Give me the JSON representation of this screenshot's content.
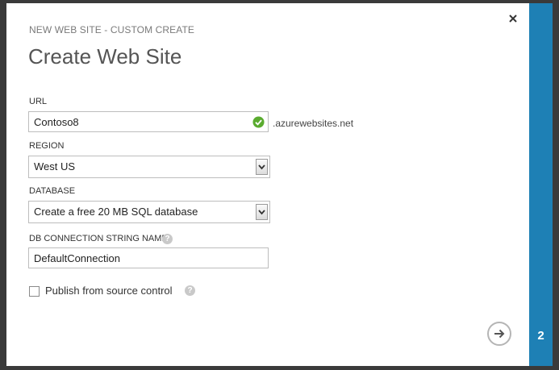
{
  "dialog": {
    "subtitle": "NEW WEB SITE - CUSTOM CREATE",
    "title": "Create Web Site",
    "step": "2"
  },
  "form": {
    "url": {
      "label": "URL",
      "value": "Contoso8",
      "suffix": ".azurewebsites.net",
      "status": "valid"
    },
    "region": {
      "label": "REGION",
      "selected": "West US"
    },
    "database": {
      "label": "DATABASE",
      "selected": "Create a free 20 MB SQL database"
    },
    "connection_string": {
      "label": "DB CONNECTION STRING NAME",
      "value": "DefaultConnection"
    },
    "publish": {
      "label": "Publish from source control",
      "checked": false
    }
  },
  "colors": {
    "accent": "#1e80b5",
    "success": "#5aab2f"
  }
}
